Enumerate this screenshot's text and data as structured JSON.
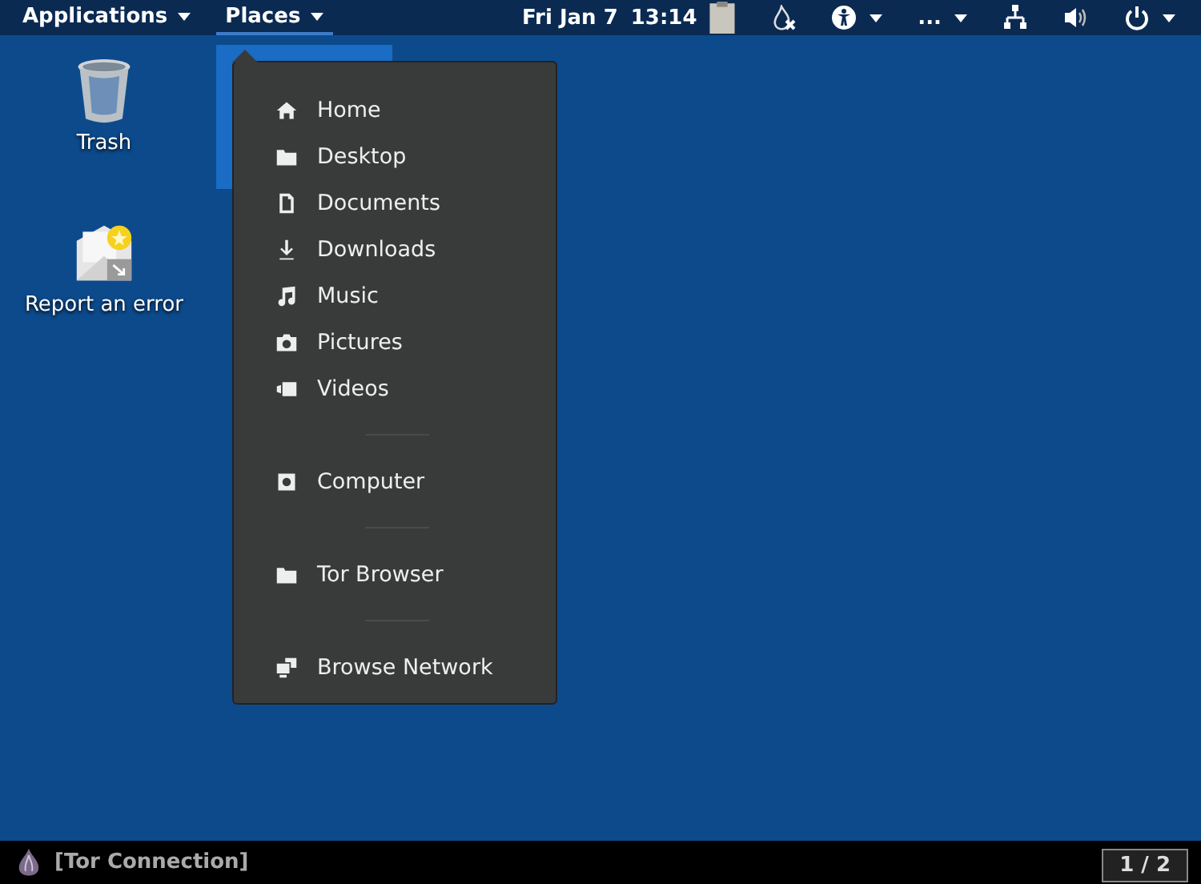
{
  "top_bar": {
    "menus": [
      {
        "label": "Applications",
        "selected": false
      },
      {
        "label": "Places",
        "selected": true
      }
    ],
    "date": "Fri Jan 7",
    "time": "13:14",
    "overflow": "..."
  },
  "desktop_icons": [
    {
      "label": "Trash"
    },
    {
      "label": "Report an error"
    }
  ],
  "places_menu": {
    "items": [
      {
        "kind": "item",
        "label": "Home"
      },
      {
        "kind": "item",
        "label": "Desktop"
      },
      {
        "kind": "item",
        "label": "Documents"
      },
      {
        "kind": "item",
        "label": "Downloads"
      },
      {
        "kind": "item",
        "label": "Music"
      },
      {
        "kind": "item",
        "label": "Pictures"
      },
      {
        "kind": "item",
        "label": "Videos"
      },
      {
        "kind": "separator"
      },
      {
        "kind": "item",
        "label": "Computer"
      },
      {
        "kind": "separator"
      },
      {
        "kind": "item",
        "label": "Tor Browser"
      },
      {
        "kind": "separator"
      },
      {
        "kind": "item",
        "label": "Browse Network"
      }
    ]
  },
  "bottom_bar": {
    "window_title": "[Tor Connection]",
    "workspace": "1 / 2"
  }
}
